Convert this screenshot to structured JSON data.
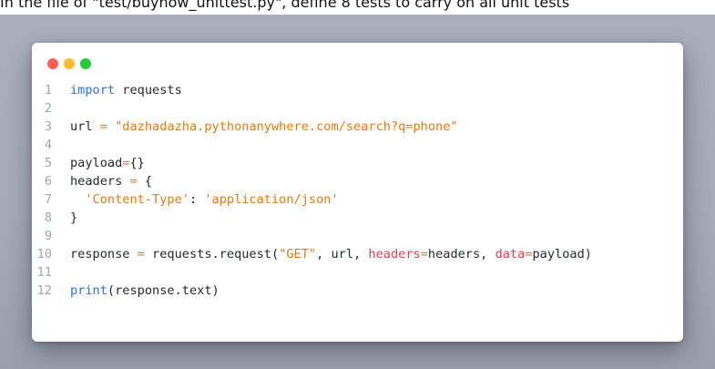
{
  "caption": "In the file of \"test/buynow_unittest.py\", define 8 tests to carry on all unit tests",
  "window": {
    "controls": {
      "close_color": "#ff5f56",
      "minimize_color": "#ffbd2e",
      "maximize_color": "#27c93f"
    }
  },
  "code": {
    "lines": [
      {
        "num": "1",
        "tokens": [
          {
            "t": "import",
            "c": "kw"
          },
          {
            "t": " requests",
            "c": "plain"
          }
        ]
      },
      {
        "num": "2",
        "tokens": []
      },
      {
        "num": "3",
        "tokens": [
          {
            "t": "url ",
            "c": "plain"
          },
          {
            "t": "=",
            "c": "op"
          },
          {
            "t": " ",
            "c": "plain"
          },
          {
            "t": "\"dazhadazha.pythonanywhere.com/search?q=phone\"",
            "c": "str"
          }
        ]
      },
      {
        "num": "4",
        "tokens": []
      },
      {
        "num": "5",
        "tokens": [
          {
            "t": "payload",
            "c": "plain"
          },
          {
            "t": "=",
            "c": "op"
          },
          {
            "t": "{}",
            "c": "plain"
          }
        ]
      },
      {
        "num": "6",
        "tokens": [
          {
            "t": "headers ",
            "c": "plain"
          },
          {
            "t": "=",
            "c": "op"
          },
          {
            "t": " {",
            "c": "plain"
          }
        ]
      },
      {
        "num": "7",
        "tokens": [
          {
            "t": "  ",
            "c": "plain"
          },
          {
            "t": "'Content-Type'",
            "c": "str"
          },
          {
            "t": ": ",
            "c": "plain"
          },
          {
            "t": "'application/json'",
            "c": "str"
          }
        ]
      },
      {
        "num": "8",
        "tokens": [
          {
            "t": "}",
            "c": "plain"
          }
        ]
      },
      {
        "num": "9",
        "tokens": []
      },
      {
        "num": "10",
        "tokens": [
          {
            "t": "response ",
            "c": "plain"
          },
          {
            "t": "=",
            "c": "op"
          },
          {
            "t": " requests.request(",
            "c": "plain"
          },
          {
            "t": "\"GET\"",
            "c": "str"
          },
          {
            "t": ", url, ",
            "c": "plain"
          },
          {
            "t": "headers",
            "c": "kwarg"
          },
          {
            "t": "=",
            "c": "op"
          },
          {
            "t": "headers, ",
            "c": "plain"
          },
          {
            "t": "data",
            "c": "kwarg"
          },
          {
            "t": "=",
            "c": "op"
          },
          {
            "t": "payload)",
            "c": "plain"
          }
        ]
      },
      {
        "num": "11",
        "tokens": []
      },
      {
        "num": "12",
        "tokens": [
          {
            "t": "print",
            "c": "fn"
          },
          {
            "t": "(response.text)",
            "c": "plain"
          }
        ]
      }
    ]
  }
}
